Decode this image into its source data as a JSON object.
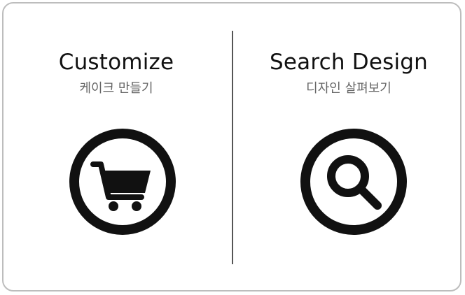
{
  "options": [
    {
      "title": "Customize",
      "subtitle": "케이크 만들기",
      "icon": "shopping-cart-icon"
    },
    {
      "title": "Search Design",
      "subtitle": "디자인 살펴보기",
      "icon": "search-icon"
    }
  ],
  "colors": {
    "text": "#111111",
    "subtext": "#666666",
    "border": "#bdbdbd",
    "divider": "#555555"
  }
}
